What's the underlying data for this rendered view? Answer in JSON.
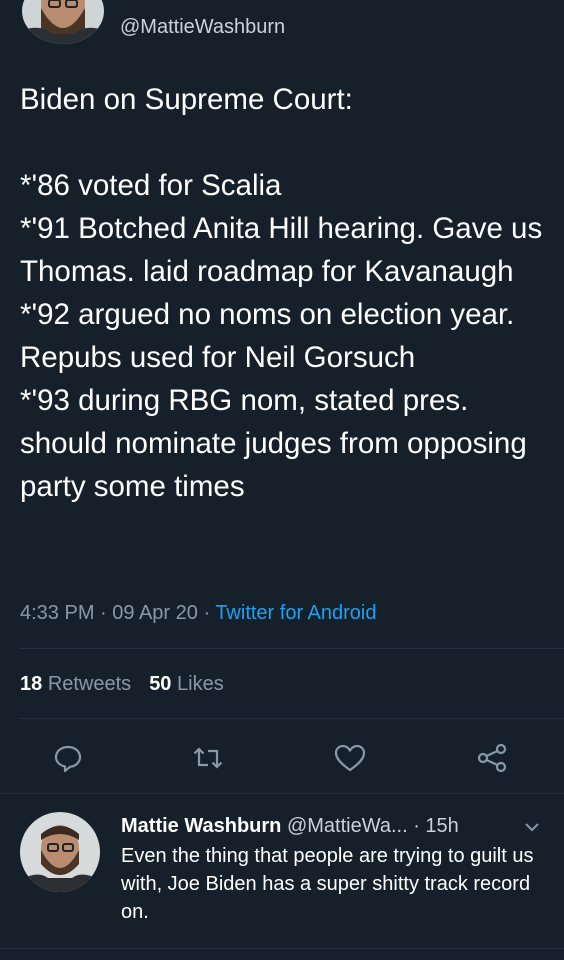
{
  "top": {
    "handle": "@MattieWashburn"
  },
  "tweet": {
    "text": "Biden on Supreme Court:\n\n*'86 voted for Scalia\n*'91 Botched Anita Hill hearing. Gave us Thomas. laid roadmap for Kavanaugh\n*'92 argued no noms on election year.  Repubs used for Neil Gorsuch\n*'93 during RBG nom, stated pres. should nominate judges from opposing party some times",
    "time": "4:33 PM",
    "date": "09 Apr 20",
    "source": "Twitter for Android",
    "separator": " · "
  },
  "stats": {
    "retweets_count": "18",
    "retweets_label": "Retweets",
    "likes_count": "50",
    "likes_label": "Likes"
  },
  "actions": {
    "icons": [
      "reply-icon",
      "retweet-icon",
      "like-icon",
      "share-icon"
    ],
    "icon_color": "#8899a6"
  },
  "reply": {
    "name": "Mattie Washburn",
    "handle": "@MattieWa...",
    "time": "15h",
    "dot": " · ",
    "text": "Even the thing that people are trying to guilt us with, Joe Biden has a super shitty track record on."
  },
  "colors": {
    "background": "#15202b",
    "text": "#ffffff",
    "muted": "#8899a6",
    "link": "#1da1f2",
    "divider": "#253341"
  }
}
